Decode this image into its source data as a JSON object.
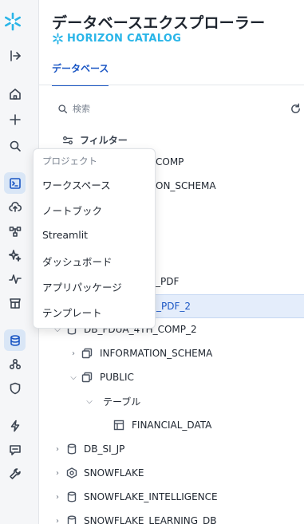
{
  "rail": {
    "icons": [
      "snowflake-logo",
      "collapse-icon",
      "home-icon",
      "plus-icon",
      "search-icon",
      "projects-icon",
      "upload-icon",
      "data-flow-icon",
      "ai-icon",
      "monitoring-icon",
      "marketplace-icon",
      "database-icon",
      "catalog-icon",
      "governance-icon",
      "admin-icon",
      "help-icon",
      "settings-icon"
    ]
  },
  "header": {
    "title": "データベースエクスプローラー",
    "subtitle": "HORIZON CATALOG",
    "accent": "#29b5e8"
  },
  "tabs": [
    {
      "label": "データベース",
      "active": true
    }
  ],
  "search": {
    "placeholder": "検索"
  },
  "filter": {
    "label": "フィルター"
  },
  "popup": {
    "header": "プロジェクト",
    "items": [
      "ワークスペース",
      "ノートブック",
      "Streamlit",
      "ダッシュボード",
      "アプリパッケージ",
      "テンプレート"
    ]
  },
  "tree": {
    "r1": "COMP",
    "r2": "ON_SCHEMA",
    "r3": "_PDF",
    "r4": "_PDF_2",
    "r5": "DB_FDUA_4TH_COMP_2",
    "r6": "INFORMATION_SCHEMA",
    "r7": "PUBLIC",
    "r8": "テーブル",
    "r9": "FINANCIAL_DATA",
    "r10": "DB_SI_JP",
    "r11": "SNOWFLAKE",
    "r12": "SNOWFLAKE_INTELLIGENCE",
    "r13": "SNOWFLAKE_LEARNING_DB"
  }
}
